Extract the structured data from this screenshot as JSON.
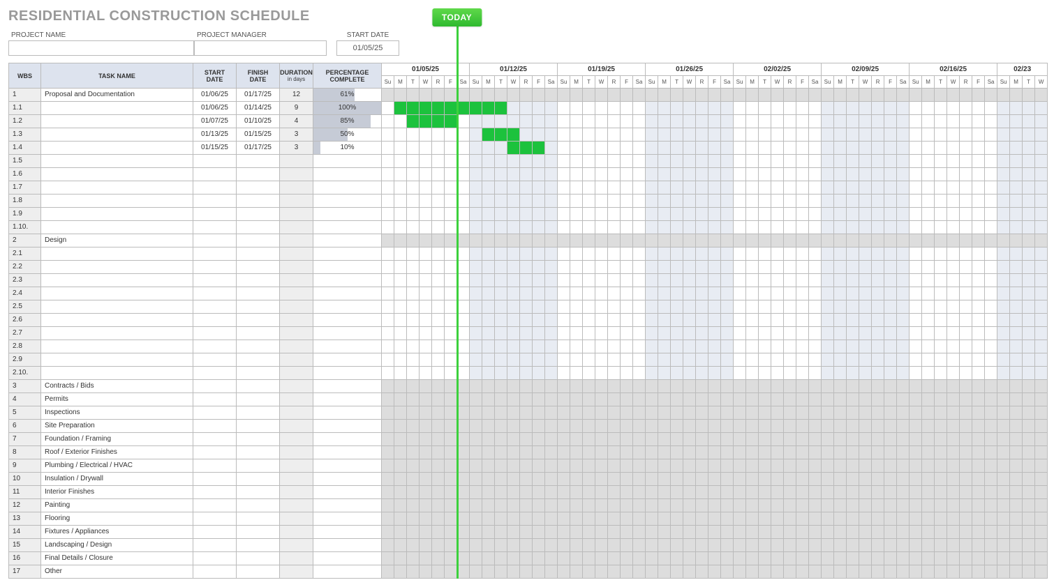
{
  "title": "RESIDENTIAL CONSTRUCTION SCHEDULE",
  "today_label": "TODAY",
  "colors": {
    "bar": "#1cc23d",
    "accent": "#3cd13c"
  },
  "meta": {
    "project_name_label": "PROJECT NAME",
    "project_name_value": "",
    "project_manager_label": "PROJECT MANAGER",
    "project_manager_value": "",
    "start_date_label": "START DATE",
    "start_date_value": "01/05/25"
  },
  "columns": {
    "wbs": "WBS",
    "task": "TASK NAME",
    "start": "START DATE",
    "finish": "FINISH DATE",
    "duration": "DURATION",
    "duration_sub": "in days",
    "percent": "PERCENTAGE COMPLETE"
  },
  "timeline": {
    "weeks": [
      "01/05/25",
      "01/12/25",
      "01/19/25",
      "01/26/25",
      "02/02/25",
      "02/09/25",
      "02/16/25",
      "02/23"
    ],
    "days_full": [
      "Su",
      "M",
      "T",
      "W",
      "R",
      "F",
      "Sa"
    ],
    "days_partial": [
      "Su",
      "M",
      "T",
      "W"
    ],
    "today_index": 5
  },
  "rows": [
    {
      "wbs": "1",
      "task": "Proposal and Documentation",
      "start": "01/06/25",
      "finish": "01/17/25",
      "dur": "12",
      "pct": 61,
      "section": true,
      "bar": null
    },
    {
      "wbs": "1.1",
      "task": "",
      "start": "01/06/25",
      "finish": "01/14/25",
      "dur": "9",
      "pct": 100,
      "section": false,
      "bar": [
        1,
        9
      ]
    },
    {
      "wbs": "1.2",
      "task": "",
      "start": "01/07/25",
      "finish": "01/10/25",
      "dur": "4",
      "pct": 85,
      "section": false,
      "bar": [
        2,
        5
      ]
    },
    {
      "wbs": "1.3",
      "task": "",
      "start": "01/13/25",
      "finish": "01/15/25",
      "dur": "3",
      "pct": 50,
      "section": false,
      "bar": [
        8,
        10
      ]
    },
    {
      "wbs": "1.4",
      "task": "",
      "start": "01/15/25",
      "finish": "01/17/25",
      "dur": "3",
      "pct": 10,
      "section": false,
      "bar": [
        10,
        12
      ]
    },
    {
      "wbs": "1.5",
      "task": "",
      "start": "",
      "finish": "",
      "dur": "",
      "pct": null,
      "section": false,
      "bar": null
    },
    {
      "wbs": "1.6",
      "task": "",
      "start": "",
      "finish": "",
      "dur": "",
      "pct": null,
      "section": false,
      "bar": null
    },
    {
      "wbs": "1.7",
      "task": "",
      "start": "",
      "finish": "",
      "dur": "",
      "pct": null,
      "section": false,
      "bar": null
    },
    {
      "wbs": "1.8",
      "task": "",
      "start": "",
      "finish": "",
      "dur": "",
      "pct": null,
      "section": false,
      "bar": null
    },
    {
      "wbs": "1.9",
      "task": "",
      "start": "",
      "finish": "",
      "dur": "",
      "pct": null,
      "section": false,
      "bar": null
    },
    {
      "wbs": "1.10.",
      "task": "",
      "start": "",
      "finish": "",
      "dur": "",
      "pct": null,
      "section": false,
      "bar": null
    },
    {
      "wbs": "2",
      "task": "Design",
      "start": "",
      "finish": "",
      "dur": "",
      "pct": null,
      "section": true,
      "bar": null
    },
    {
      "wbs": "2.1",
      "task": "",
      "start": "",
      "finish": "",
      "dur": "",
      "pct": null,
      "section": false,
      "bar": null
    },
    {
      "wbs": "2.2",
      "task": "",
      "start": "",
      "finish": "",
      "dur": "",
      "pct": null,
      "section": false,
      "bar": null
    },
    {
      "wbs": "2.3",
      "task": "",
      "start": "",
      "finish": "",
      "dur": "",
      "pct": null,
      "section": false,
      "bar": null
    },
    {
      "wbs": "2.4",
      "task": "",
      "start": "",
      "finish": "",
      "dur": "",
      "pct": null,
      "section": false,
      "bar": null
    },
    {
      "wbs": "2.5",
      "task": "",
      "start": "",
      "finish": "",
      "dur": "",
      "pct": null,
      "section": false,
      "bar": null
    },
    {
      "wbs": "2.6",
      "task": "",
      "start": "",
      "finish": "",
      "dur": "",
      "pct": null,
      "section": false,
      "bar": null
    },
    {
      "wbs": "2.7",
      "task": "",
      "start": "",
      "finish": "",
      "dur": "",
      "pct": null,
      "section": false,
      "bar": null
    },
    {
      "wbs": "2.8",
      "task": "",
      "start": "",
      "finish": "",
      "dur": "",
      "pct": null,
      "section": false,
      "bar": null
    },
    {
      "wbs": "2.9",
      "task": "",
      "start": "",
      "finish": "",
      "dur": "",
      "pct": null,
      "section": false,
      "bar": null
    },
    {
      "wbs": "2.10.",
      "task": "",
      "start": "",
      "finish": "",
      "dur": "",
      "pct": null,
      "section": false,
      "bar": null
    },
    {
      "wbs": "3",
      "task": "Contracts / Bids",
      "start": "",
      "finish": "",
      "dur": "",
      "pct": null,
      "section": true,
      "bar": null
    },
    {
      "wbs": "4",
      "task": "Permits",
      "start": "",
      "finish": "",
      "dur": "",
      "pct": null,
      "section": true,
      "bar": null
    },
    {
      "wbs": "5",
      "task": "Inspections",
      "start": "",
      "finish": "",
      "dur": "",
      "pct": null,
      "section": true,
      "bar": null
    },
    {
      "wbs": "6",
      "task": "Site Preparation",
      "start": "",
      "finish": "",
      "dur": "",
      "pct": null,
      "section": true,
      "bar": null
    },
    {
      "wbs": "7",
      "task": "Foundation / Framing",
      "start": "",
      "finish": "",
      "dur": "",
      "pct": null,
      "section": true,
      "bar": null
    },
    {
      "wbs": "8",
      "task": "Roof / Exterior Finishes",
      "start": "",
      "finish": "",
      "dur": "",
      "pct": null,
      "section": true,
      "bar": null
    },
    {
      "wbs": "9",
      "task": "Plumbing / Electrical / HVAC",
      "start": "",
      "finish": "",
      "dur": "",
      "pct": null,
      "section": true,
      "bar": null
    },
    {
      "wbs": "10",
      "task": "Insulation / Drywall",
      "start": "",
      "finish": "",
      "dur": "",
      "pct": null,
      "section": true,
      "bar": null
    },
    {
      "wbs": "11",
      "task": "Interior Finishes",
      "start": "",
      "finish": "",
      "dur": "",
      "pct": null,
      "section": true,
      "bar": null
    },
    {
      "wbs": "12",
      "task": "Painting",
      "start": "",
      "finish": "",
      "dur": "",
      "pct": null,
      "section": true,
      "bar": null
    },
    {
      "wbs": "13",
      "task": "Flooring",
      "start": "",
      "finish": "",
      "dur": "",
      "pct": null,
      "section": true,
      "bar": null
    },
    {
      "wbs": "14",
      "task": "Fixtures / Appliances",
      "start": "",
      "finish": "",
      "dur": "",
      "pct": null,
      "section": true,
      "bar": null
    },
    {
      "wbs": "15",
      "task": "Landscaping / Design",
      "start": "",
      "finish": "",
      "dur": "",
      "pct": null,
      "section": true,
      "bar": null
    },
    {
      "wbs": "16",
      "task": "Final Details / Closure",
      "start": "",
      "finish": "",
      "dur": "",
      "pct": null,
      "section": true,
      "bar": null
    },
    {
      "wbs": "17",
      "task": "Other",
      "start": "",
      "finish": "",
      "dur": "",
      "pct": null,
      "section": true,
      "bar": null
    }
  ],
  "shaded_day_ranges": [
    [
      7,
      13
    ],
    [
      21,
      27
    ],
    [
      35,
      41
    ],
    [
      49,
      52
    ]
  ]
}
